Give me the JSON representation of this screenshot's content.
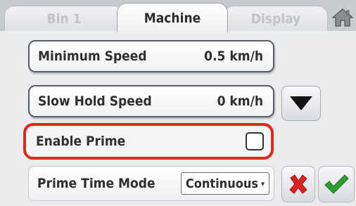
{
  "tabs": [
    {
      "label": "Bin 1",
      "active": false
    },
    {
      "label": "Machine",
      "active": true
    },
    {
      "label": "Display",
      "active": false
    }
  ],
  "settings": {
    "minimum_speed": {
      "label": "Minimum Speed",
      "value": "0.5 km/h"
    },
    "slow_hold_speed": {
      "label": "Slow Hold Speed",
      "value": "0 km/h"
    },
    "enable_prime": {
      "label": "Enable Prime",
      "checked": false,
      "highlight_color": "#e8231d"
    },
    "prime_time_mode": {
      "label": "Prime Time Mode",
      "selected": "Continuous"
    }
  },
  "icons": {
    "home": "home-icon",
    "scroll_down": "triangle-down-icon",
    "cancel": "x-cross-icon",
    "confirm": "checkmark-icon"
  },
  "colors": {
    "highlight": "#e8231d",
    "cancel": "#e02020",
    "confirm": "#2e9e2e"
  }
}
